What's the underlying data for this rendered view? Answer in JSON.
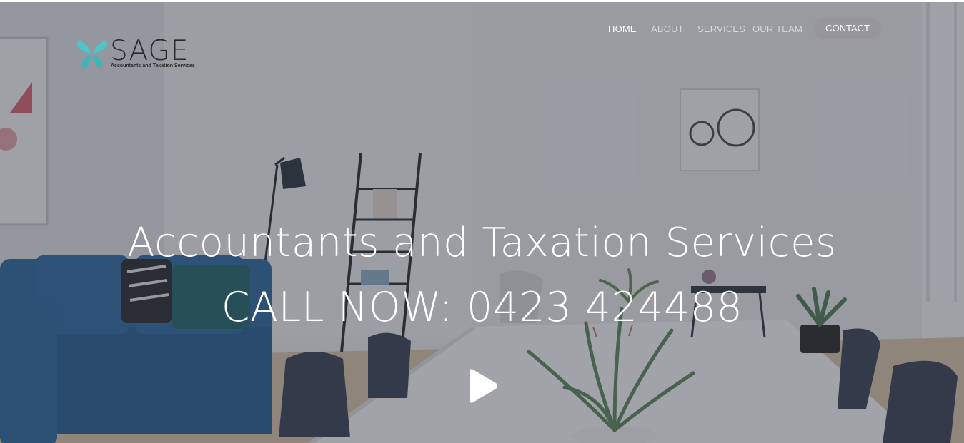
{
  "logo": {
    "name": "SAGE",
    "tagline": "Accountants and Taxation Services"
  },
  "nav": {
    "items": [
      {
        "label": "HOME",
        "active": true
      },
      {
        "label": "ABOUT",
        "active": false
      },
      {
        "label": "SERVICES",
        "active": false
      },
      {
        "label": "OUR TEAM",
        "active": false
      }
    ],
    "contact_label": "CONTACT"
  },
  "hero": {
    "title": "Accountants and Taxation Services",
    "phone_line": "CALL NOW: 0423 424488",
    "play_icon": "play-icon"
  },
  "colors": {
    "brand_teal": "#4ec3c9",
    "text_white": "#ffffff",
    "sofa_blue": "#2f6da3"
  }
}
